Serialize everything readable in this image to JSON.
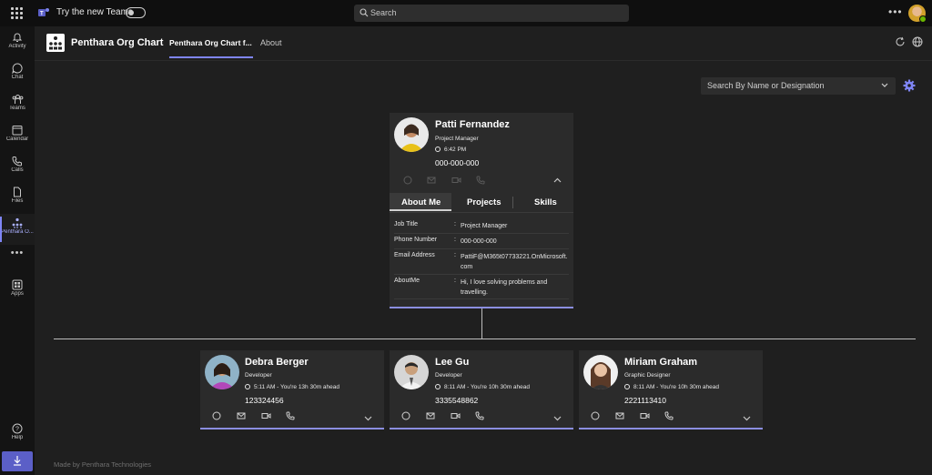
{
  "topbar": {
    "try_new_teams": "Try the new Teams",
    "search_placeholder": "Search",
    "more": "•••"
  },
  "rail": {
    "items": [
      {
        "label": "Activity",
        "icon": "bell-icon"
      },
      {
        "label": "Chat",
        "icon": "chat-icon"
      },
      {
        "label": "Teams",
        "icon": "teams-icon"
      },
      {
        "label": "Calendar",
        "icon": "calendar-icon"
      },
      {
        "label": "Calls",
        "icon": "phone-icon"
      },
      {
        "label": "Files",
        "icon": "file-icon"
      },
      {
        "label": "Penthara O...",
        "icon": "org-chart-icon"
      }
    ],
    "more": "•••",
    "apps": "Apps",
    "help": "Help"
  },
  "app": {
    "title": "Penthara Org Chart",
    "tabs": [
      "Penthara Org Chart f...",
      "About"
    ]
  },
  "search_by": {
    "placeholder": "Search By Name or Designation"
  },
  "manager": {
    "name": "Patti Fernandez",
    "role": "Project Manager",
    "time": "6:42 PM",
    "phone": "000-000-000",
    "tabs": [
      "About Me",
      "Projects",
      "Skills"
    ],
    "details": [
      {
        "key": "Job Title",
        "sep": ":",
        "value": "Project Manager"
      },
      {
        "key": "Phone Number",
        "sep": ":",
        "value": "000-000-000"
      },
      {
        "key": "Email Address",
        "sep": ":",
        "value": "PattiF@M365t07733221.OnMicrosoft.com"
      },
      {
        "key": "AboutMe",
        "sep": ":",
        "value": "Hi, I love solving problems and travelling."
      }
    ]
  },
  "reports": [
    {
      "name": "Debra Berger",
      "role": "Developer",
      "time": "5:11 AM - You're 13h 30m ahead",
      "phone": "123324456"
    },
    {
      "name": "Lee Gu",
      "role": "Developer",
      "time": "8:11 AM - You're 10h 30m ahead",
      "phone": "3335548862"
    },
    {
      "name": "Miriam Graham",
      "role": "Graphic Designer",
      "time": "8:11 AM - You're 10h 30m ahead",
      "phone": "2221113410"
    }
  ],
  "footer": "Made by Penthara Technologies",
  "colors": {
    "accent": "#7f85f5",
    "card": "#2b2b2b",
    "background": "#1f1f1f"
  }
}
